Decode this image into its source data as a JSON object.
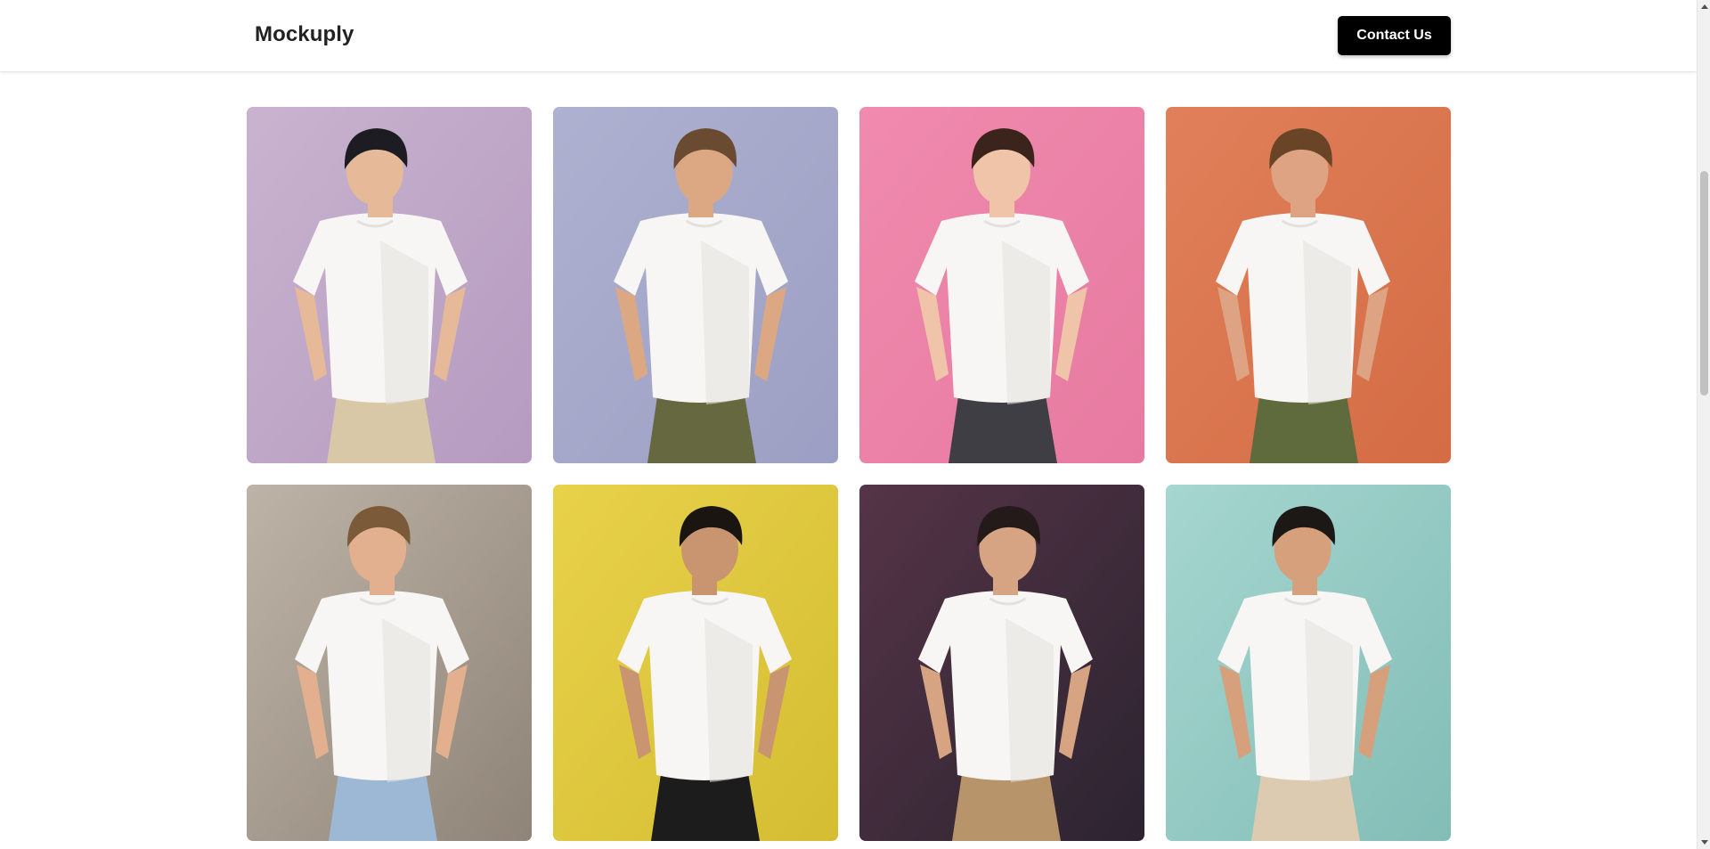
{
  "header": {
    "brand": "Mockuply",
    "contact_label": "Contact Us"
  },
  "gallery": {
    "items": [
      {
        "name": "mockup-lilac-wall",
        "background": "#c9b3cf",
        "backdrop_dark": "#b59bc0",
        "skin": "#e6b998",
        "hair": "#1c1c22",
        "pants": "#d8c8a8"
      },
      {
        "name": "mockup-cloud-sky",
        "background": "#aeb1d0",
        "backdrop_dark": "#9c9fc3",
        "skin": "#dca884",
        "hair": "#6a4a30",
        "pants": "#66683f"
      },
      {
        "name": "mockup-pink-backdrop",
        "background": "#f08aae",
        "backdrop_dark": "#e77aa0",
        "skin": "#f0c4a8",
        "hair": "#3a241c",
        "pants": "#3e3e44"
      },
      {
        "name": "mockup-orange-backdrop",
        "background": "#e0805a",
        "backdrop_dark": "#d46c45",
        "skin": "#dda383",
        "hair": "#6a4426",
        "pants": "#5f6a3d"
      },
      {
        "name": "mockup-studio-lights",
        "background": "#bdb3a6",
        "backdrop_dark": "#8f8478",
        "skin": "#e2b08e",
        "hair": "#7a5a38",
        "pants": "#9db8d4"
      },
      {
        "name": "mockup-yellow-wall",
        "background": "#e8d24a",
        "backdrop_dark": "#d4bd32",
        "skin": "#c99470",
        "hair": "#1b1512",
        "pants": "#1c1c1c"
      },
      {
        "name": "mockup-plum-studio",
        "background": "#553447",
        "backdrop_dark": "#2c2430",
        "skin": "#d6a483",
        "hair": "#241a1a",
        "pants": "#b8946a"
      },
      {
        "name": "mockup-mint-wall",
        "background": "#a6d6d0",
        "backdrop_dark": "#82bdb6",
        "skin": "#d6a07c",
        "hair": "#1c1816",
        "pants": "#dccbb0"
      }
    ]
  },
  "colors": {
    "shirt": "#f7f6f4",
    "shirt_shadow": "#e3e1dd",
    "button_bg": "#000000",
    "button_text": "#ffffff"
  }
}
